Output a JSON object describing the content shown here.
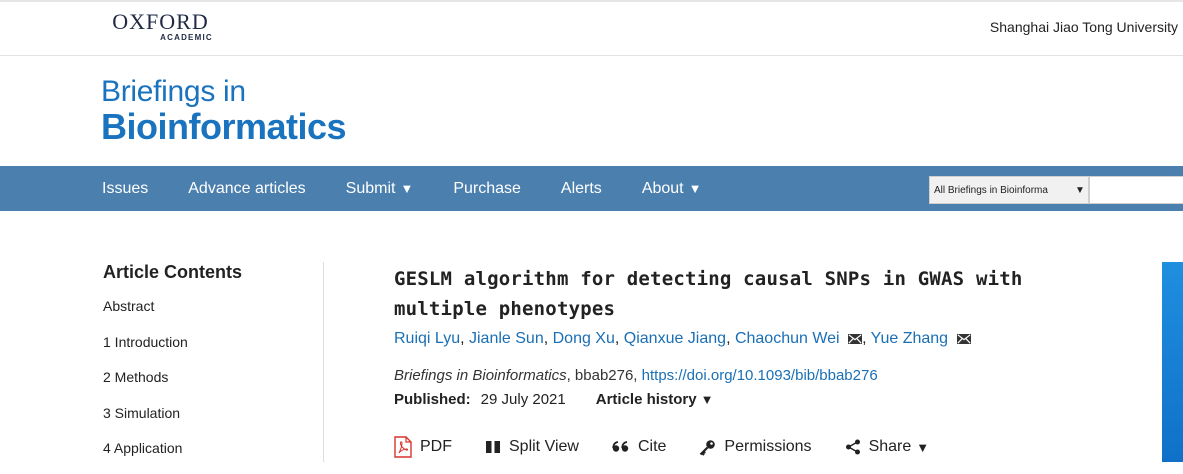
{
  "header": {
    "publisher_name": "OXFORD",
    "publisher_sub": "ACADEMIC",
    "institution": "Shanghai Jiao Tong University"
  },
  "journal": {
    "line1": "Briefings in",
    "line2": "Bioinformatics"
  },
  "nav": {
    "items": [
      {
        "label": "Issues",
        "has_caret": false
      },
      {
        "label": "Advance articles",
        "has_caret": false
      },
      {
        "label": "Submit",
        "has_caret": true
      },
      {
        "label": "Purchase",
        "has_caret": false
      },
      {
        "label": "Alerts",
        "has_caret": false
      },
      {
        "label": "About",
        "has_caret": true
      }
    ],
    "caret": "▼",
    "search_scope": "All Briefings in Bioinforma",
    "search_scope_caret": "▼",
    "search_placeholder": ""
  },
  "sidebar": {
    "heading": "Article Contents",
    "items": [
      "Abstract",
      "1 Introduction",
      "2 Methods",
      "3 Simulation",
      "4 Application"
    ]
  },
  "article": {
    "title": "GESLM algorithm for detecting causal SNPs in GWAS with multiple phenotypes",
    "authors": [
      {
        "name": "Ruiqi Lyu",
        "corresponding": false
      },
      {
        "name": "Jianle Sun",
        "corresponding": false
      },
      {
        "name": "Dong Xu",
        "corresponding": false
      },
      {
        "name": "Qianxue Jiang",
        "corresponding": false
      },
      {
        "name": "Chaochun Wei",
        "corresponding": true
      },
      {
        "name": "Yue Zhang",
        "corresponding": true
      }
    ],
    "journal_name": "Briefings in Bioinformatics",
    "article_id": ", bbab276, ",
    "doi": "https://doi.org/10.1093/bib/bbab276",
    "published_label": "Published:",
    "published_date": "29 July 2021",
    "history_label": "Article history",
    "history_caret": "▼",
    "tools": [
      {
        "label": "PDF",
        "icon": "pdf-icon"
      },
      {
        "label": "Split View",
        "icon": "split-view-icon"
      },
      {
        "label": "Cite",
        "icon": "quote-icon"
      },
      {
        "label": "Permissions",
        "icon": "key-icon"
      },
      {
        "label": "Share",
        "icon": "share-icon",
        "caret": "▼"
      }
    ]
  },
  "colors": {
    "nav_bg": "#4a7fae",
    "link": "#1a6fb5",
    "brand_blue": "#1a73be",
    "pdf_red": "#d9342b"
  }
}
